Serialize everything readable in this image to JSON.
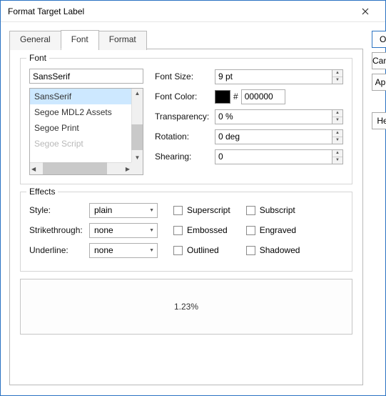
{
  "window": {
    "title": "Format Target Label"
  },
  "tabs": {
    "general": "General",
    "font": "Font",
    "format": "Format",
    "active": "font"
  },
  "buttons": {
    "ok": "OK",
    "cancel": "Cancel",
    "apply": "Apply",
    "help": "Help"
  },
  "font_group": {
    "title": "Font",
    "current": "SansSerif",
    "list": [
      "SansSerif",
      "Segoe MDL2 Assets",
      "Segoe Print",
      "Segoe Script"
    ],
    "selected_index": 0,
    "labels": {
      "size": "Font Size:",
      "color": "Font Color:",
      "transparency": "Transparency:",
      "rotation": "Rotation:",
      "shearing": "Shearing:"
    },
    "values": {
      "size": "9 pt",
      "color_hex": "000000",
      "transparency": "0 %",
      "rotation": "0 deg",
      "shearing": "0"
    }
  },
  "effects_group": {
    "title": "Effects",
    "labels": {
      "style": "Style:",
      "strike": "Strikethrough:",
      "underline": "Underline:",
      "superscript": "Superscript",
      "subscript": "Subscript",
      "embossed": "Embossed",
      "engraved": "Engraved",
      "outlined": "Outlined",
      "shadowed": "Shadowed"
    },
    "values": {
      "style": "plain",
      "strike": "none",
      "underline": "none"
    }
  },
  "preview": {
    "text": "1.23%"
  }
}
